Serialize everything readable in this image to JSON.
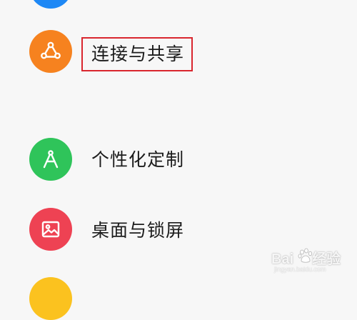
{
  "settings": {
    "items": [
      {
        "label": "连接与共享",
        "icon": "share-connection-icon",
        "color": "#f6821f",
        "highlighted": true
      },
      {
        "label": "个性化定制",
        "icon": "compass-personalize-icon",
        "color": "#2fc45a",
        "highlighted": false
      },
      {
        "label": "桌面与锁屏",
        "icon": "picture-frame-icon",
        "color": "#ee4253",
        "highlighted": false
      }
    ],
    "partial_top_color": "#1e88f5",
    "partial_bottom_color": "#fbc21f"
  },
  "watermark": {
    "brand": "Bai",
    "brand_suffix": "经验",
    "url": "jingyan.baidu.com"
  },
  "highlight_color": "#d9262e"
}
